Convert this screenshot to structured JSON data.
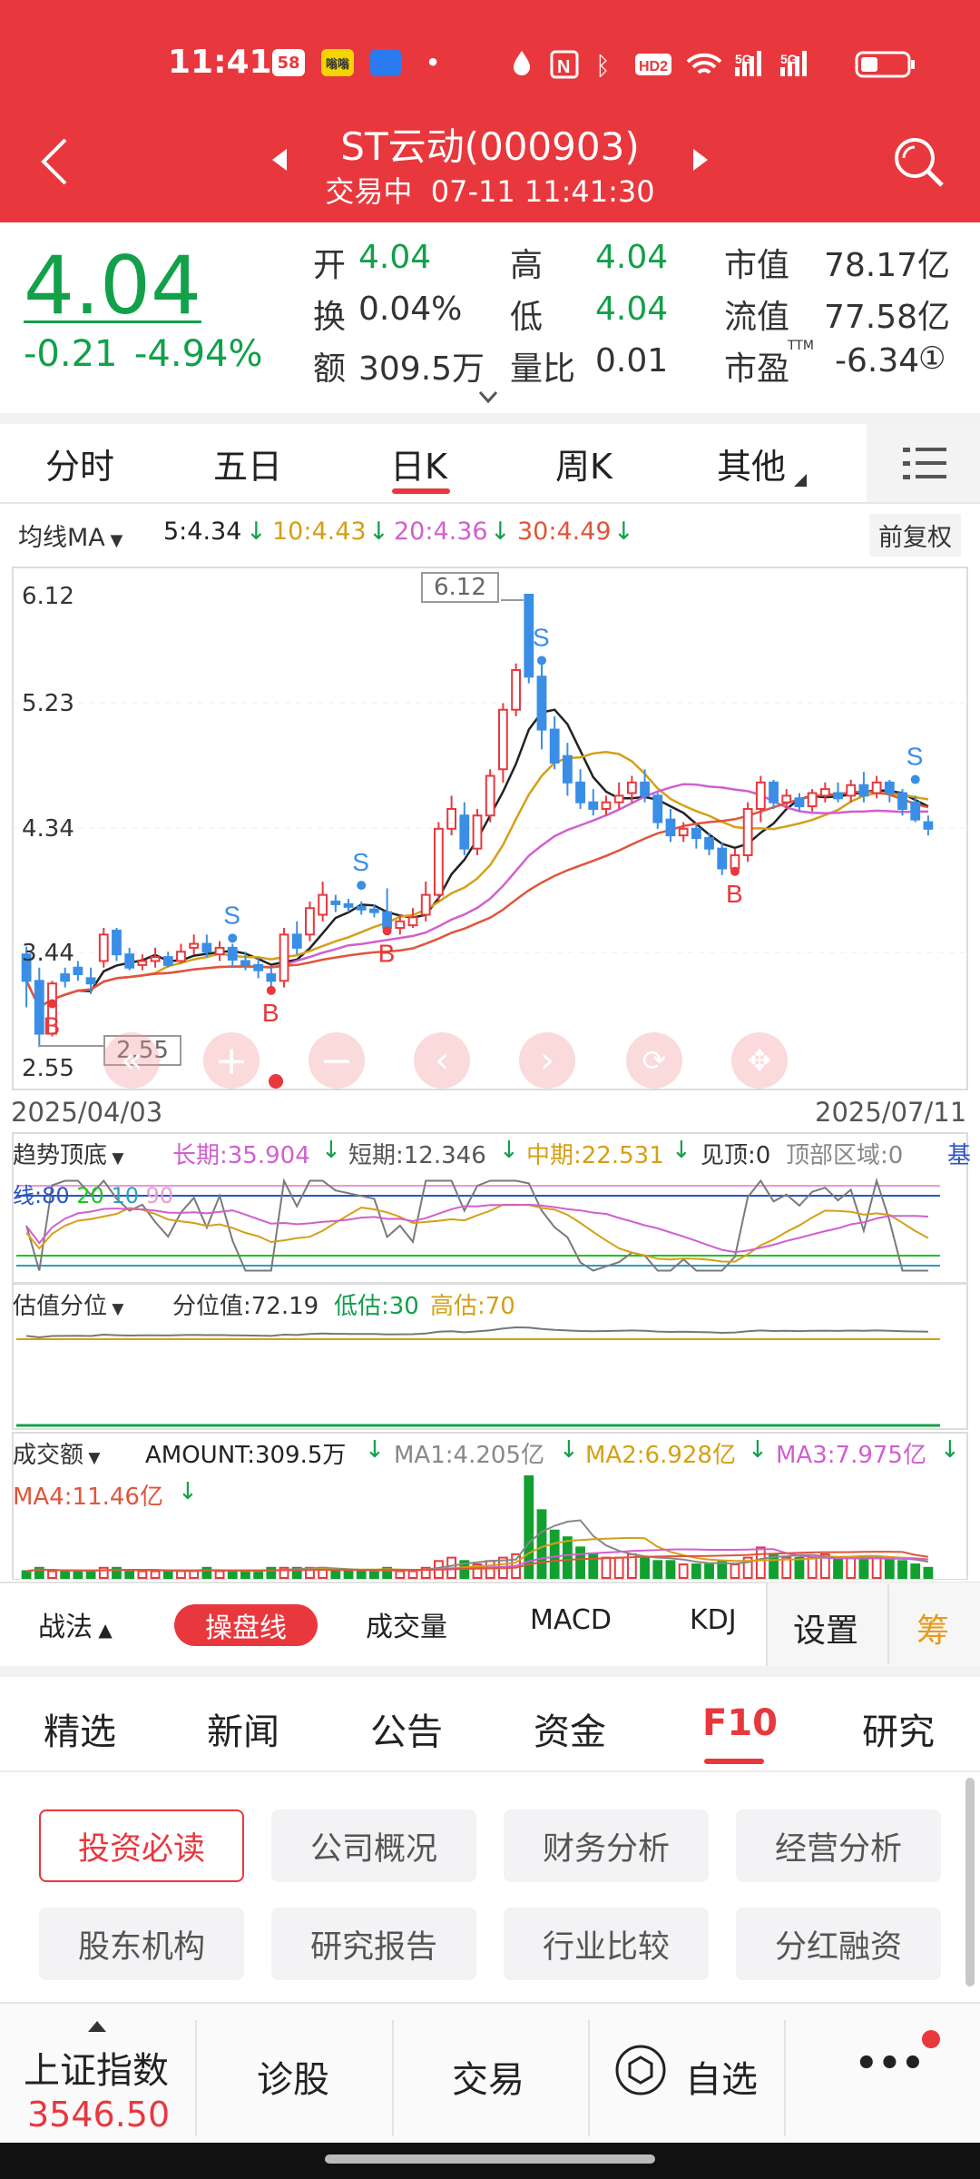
{
  "status_bar": {
    "time": "11:41",
    "badges": [
      "58",
      "嗡嗡",
      "•"
    ],
    "battery": "low"
  },
  "header": {
    "title": "ST云动(000903)",
    "subtitle": "交易中  07-11 11:41:30",
    "back_icon": "chevron-left-icon",
    "search_icon": "search-icon"
  },
  "quote": {
    "price": "4.04",
    "change": "-0.21",
    "change_pct": "-4.94%",
    "open_label": "开",
    "open": "4.04",
    "high_label": "高",
    "high": "4.04",
    "mktcap_label": "市值",
    "mktcap": "78.17亿",
    "turnover_label": "换",
    "turnover": "0.04%",
    "low_label": "低",
    "low": "4.04",
    "float_label": "流值",
    "float_cap": "77.58亿",
    "amount_label": "额",
    "amount": "309.5万",
    "volratio_label": "量比",
    "volratio": "0.01",
    "pe_label": "市盈",
    "pe_sup": "TTM",
    "pe": "-6.34",
    "pe_info": "①"
  },
  "period_tabs": [
    "分时",
    "五日",
    "日K",
    "周K",
    "其他"
  ],
  "ma_bar": {
    "label": "均线MA",
    "ma5": "5:4.34",
    "ma10": "10:4.43",
    "ma20": "20:4.36",
    "ma30": "30:4.49",
    "adjust": "前复权"
  },
  "price_axis": {
    "max": "6.12",
    "l2": "5.23",
    "l3": "4.34",
    "l4": "3.44",
    "min": "2.55"
  },
  "annot": {
    "high_tag": "6.12",
    "low_tag": "2.55",
    "buy": "B",
    "sell": "S"
  },
  "dates": {
    "start": "2025/04/03",
    "end": "2025/07/11"
  },
  "trend": {
    "label": "趋势顶底",
    "long": "长期:35.904",
    "short": "短期:12.346",
    "mid": "中期:22.531",
    "top": "见顶:0",
    "zone": "顶部区域:0",
    "base": "基",
    "line2a": "线:80",
    "line2b": "20",
    "line2c": "10",
    "line2d": "90"
  },
  "valuation": {
    "label": "估值分位",
    "value": "分位值:72.19",
    "low": "低估:30",
    "high": "高估:70"
  },
  "volume": {
    "label": "成交额",
    "amount": "AMOUNT:309.5万",
    "ma1": "MA1:4.205亿",
    "ma2": "MA2:6.928亿",
    "ma3": "MA3:7.975亿",
    "ma4": "MA4:11.46亿"
  },
  "tools": {
    "zhanfa": "战法",
    "caopan": "操盘线",
    "chengjiao": "成交量",
    "macd": "MACD",
    "kdj": "KDJ",
    "settings": "设置",
    "chou": "筹"
  },
  "news_tabs": [
    "精选",
    "新闻",
    "公告",
    "资金",
    "F10",
    "研究"
  ],
  "f10_cards": [
    "投资必读",
    "公司概况",
    "财务分析",
    "经营分析",
    "股东机构",
    "研究报告",
    "行业比较",
    "分红融资"
  ],
  "bottom_nav": {
    "index_name": "上证指数",
    "index_value": "3546.50",
    "diagnose": "诊股",
    "trade": "交易",
    "watchlist": "自选",
    "more": "•••"
  },
  "colors": {
    "red": "#e8383d",
    "green": "#12a04a",
    "ma5": "#222222",
    "ma10": "#d4a017",
    "ma20": "#d05fd0",
    "ma30": "#e0553a",
    "orange": "#e89a1c"
  },
  "chart_data": {
    "type": "candlestick",
    "ylim": [
      2.55,
      6.12
    ],
    "candles": [
      [
        3.4,
        3.46,
        3.2,
        3.0
      ],
      [
        3.2,
        3.3,
        2.8,
        2.7
      ],
      [
        2.8,
        3.2,
        3.18,
        2.78
      ],
      [
        3.25,
        3.3,
        3.2,
        3.15
      ],
      [
        3.3,
        3.35,
        3.25,
        3.2
      ],
      [
        3.22,
        3.3,
        3.18,
        3.1
      ],
      [
        3.35,
        3.6,
        3.55,
        3.3
      ],
      [
        3.58,
        3.6,
        3.4,
        3.35
      ],
      [
        3.4,
        3.45,
        3.3,
        3.28
      ],
      [
        3.32,
        3.4,
        3.35,
        3.28
      ],
      [
        3.35,
        3.45,
        3.38,
        3.3
      ],
      [
        3.38,
        3.42,
        3.32,
        3.3
      ],
      [
        3.35,
        3.48,
        3.42,
        3.33
      ],
      [
        3.45,
        3.55,
        3.48,
        3.4
      ],
      [
        3.48,
        3.55,
        3.42,
        3.38
      ],
      [
        3.4,
        3.5,
        3.45,
        3.35
      ],
      [
        3.45,
        3.48,
        3.36,
        3.3
      ],
      [
        3.35,
        3.42,
        3.32,
        3.28
      ],
      [
        3.32,
        3.38,
        3.28,
        3.22
      ],
      [
        3.25,
        3.3,
        3.2,
        3.1
      ],
      [
        3.2,
        3.6,
        3.55,
        3.15
      ],
      [
        3.55,
        3.65,
        3.45,
        3.4
      ],
      [
        3.55,
        3.8,
        3.75,
        3.5
      ],
      [
        3.7,
        3.95,
        3.85,
        3.65
      ],
      [
        3.8,
        3.85,
        3.78,
        3.72
      ],
      [
        3.78,
        3.82,
        3.76,
        3.72
      ],
      [
        3.76,
        3.8,
        3.74,
        3.7
      ],
      [
        3.74,
        3.78,
        3.72,
        3.68
      ],
      [
        3.72,
        3.9,
        3.6,
        3.55
      ],
      [
        3.6,
        3.7,
        3.65,
        3.55
      ],
      [
        3.62,
        3.75,
        3.68,
        3.6
      ],
      [
        3.7,
        3.95,
        3.85,
        3.65
      ],
      [
        3.85,
        4.4,
        4.35,
        3.8
      ],
      [
        4.35,
        4.6,
        4.5,
        4.3
      ],
      [
        4.45,
        4.55,
        4.2,
        4.15
      ],
      [
        4.2,
        4.5,
        4.45,
        4.15
      ],
      [
        4.45,
        4.8,
        4.75,
        4.4
      ],
      [
        4.8,
        5.3,
        5.25,
        4.7
      ],
      [
        5.25,
        5.6,
        5.55,
        5.2
      ],
      [
        6.12,
        6.12,
        5.5,
        5.45
      ],
      [
        5.5,
        5.6,
        5.1,
        4.95
      ],
      [
        5.1,
        5.2,
        4.85,
        4.8
      ],
      [
        4.9,
        5.0,
        4.7,
        4.6
      ],
      [
        4.7,
        4.8,
        4.55,
        4.5
      ],
      [
        4.55,
        4.65,
        4.5,
        4.45
      ],
      [
        4.5,
        4.6,
        4.55,
        4.45
      ],
      [
        4.55,
        4.7,
        4.6,
        4.5
      ],
      [
        4.62,
        4.75,
        4.7,
        4.55
      ],
      [
        4.7,
        4.8,
        4.6,
        4.55
      ],
      [
        4.6,
        4.62,
        4.4,
        4.35
      ],
      [
        4.42,
        4.5,
        4.3,
        4.25
      ],
      [
        4.3,
        4.4,
        4.35,
        4.25
      ],
      [
        4.35,
        4.38,
        4.28,
        4.2
      ],
      [
        4.28,
        4.32,
        4.2,
        4.15
      ],
      [
        4.2,
        4.25,
        4.05,
        4.0
      ],
      [
        4.05,
        4.2,
        4.15,
        4.0
      ],
      [
        4.15,
        4.55,
        4.5,
        4.1
      ],
      [
        4.5,
        4.75,
        4.7,
        4.4
      ],
      [
        4.7,
        4.72,
        4.55,
        4.5
      ],
      [
        4.55,
        4.65,
        4.6,
        4.5
      ],
      [
        4.58,
        4.62,
        4.52,
        4.48
      ],
      [
        4.52,
        4.65,
        4.62,
        4.48
      ],
      [
        4.6,
        4.7,
        4.65,
        4.55
      ],
      [
        4.62,
        4.7,
        4.58,
        4.55
      ],
      [
        4.6,
        4.72,
        4.68,
        4.55
      ],
      [
        4.68,
        4.78,
        4.6,
        4.55
      ],
      [
        4.62,
        4.75,
        4.7,
        4.58
      ],
      [
        4.7,
        4.72,
        4.62,
        4.55
      ],
      [
        4.62,
        4.65,
        4.5,
        4.45
      ],
      [
        4.55,
        4.6,
        4.42,
        4.4
      ],
      [
        4.4,
        4.45,
        4.35,
        4.3
      ]
    ],
    "volume_bars": [
      2,
      3,
      2,
      2,
      2,
      2,
      3,
      3,
      2,
      2,
      2,
      2,
      2,
      2,
      3,
      2,
      2,
      2,
      2,
      3,
      3,
      3,
      3,
      3,
      2,
      2,
      2,
      2,
      3,
      2,
      2,
      3,
      5,
      6,
      5,
      4,
      5,
      6,
      7,
      30,
      20,
      14,
      12,
      9,
      7,
      6,
      6,
      7,
      6,
      5,
      5,
      4,
      4,
      4,
      5,
      4,
      6,
      9,
      7,
      6,
      6,
      6,
      7,
      6,
      6,
      6,
      6,
      6,
      5,
      4,
      3
    ]
  }
}
